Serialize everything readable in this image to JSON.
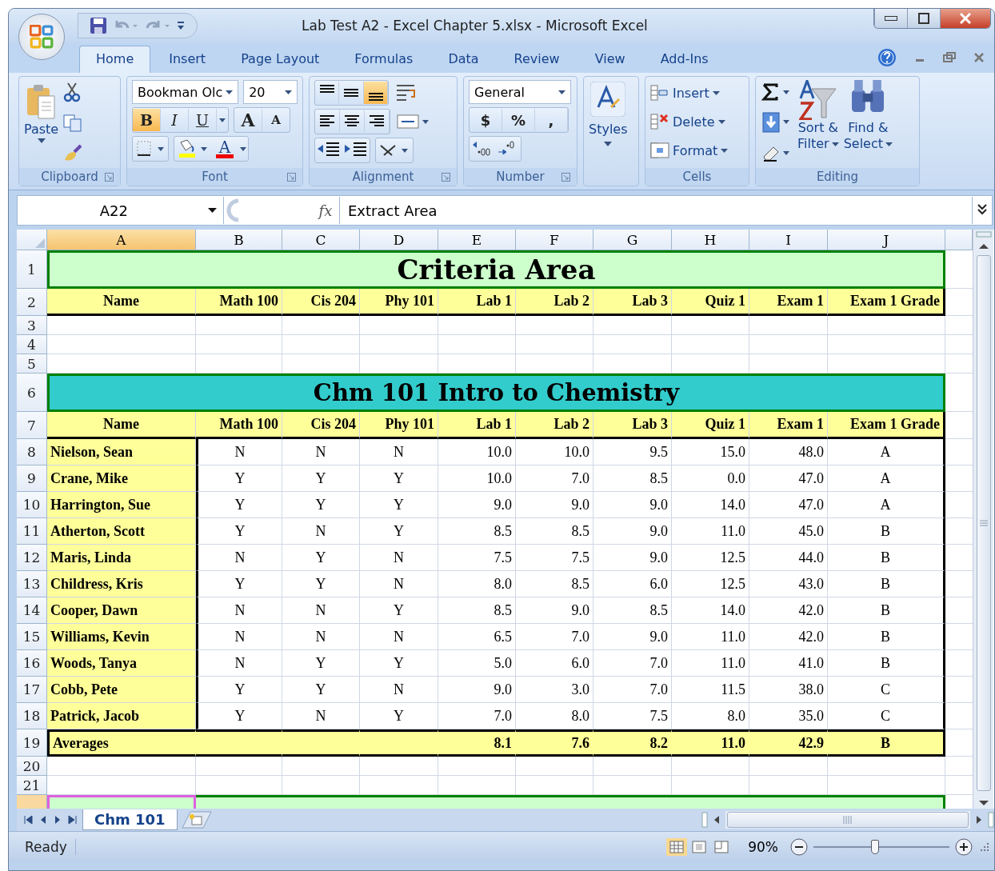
{
  "window": {
    "title": "Lab Test A2 - Excel Chapter 5.xlsx - Microsoft Excel"
  },
  "tabs": [
    {
      "label": "Home",
      "selected": true
    },
    {
      "label": "Insert",
      "selected": false
    },
    {
      "label": "Page Layout",
      "selected": false
    },
    {
      "label": "Formulas",
      "selected": false
    },
    {
      "label": "Data",
      "selected": false
    },
    {
      "label": "Review",
      "selected": false
    },
    {
      "label": "View",
      "selected": false
    },
    {
      "label": "Add-Ins",
      "selected": false
    }
  ],
  "ribbon": {
    "clipboard": {
      "label": "Clipboard",
      "paste": "Paste"
    },
    "font": {
      "label": "Font",
      "name": "Bookman Olc",
      "size": "20",
      "styles": [
        {
          "text": "B",
          "kind": "bold",
          "selected": true
        },
        {
          "text": "I",
          "kind": "italic",
          "selected": false
        },
        {
          "text": "U",
          "kind": "underline",
          "selected": false
        }
      ],
      "grow": "A",
      "shrink": "A",
      "color_letter": "A"
    },
    "alignment": {
      "label": "Alignment",
      "vertical": [
        {
          "kind": "top",
          "selected": false
        },
        {
          "kind": "middle",
          "selected": false
        },
        {
          "kind": "bottom",
          "selected": true
        }
      ]
    },
    "number": {
      "label": "Number",
      "format": "General",
      "symbols": [
        "$",
        "%",
        ","
      ]
    },
    "styles": {
      "label": "Styles"
    },
    "cells": {
      "label": "Cells",
      "buttons": [
        "Insert",
        "Delete",
        "Format"
      ]
    },
    "editing": {
      "label": "Editing",
      "sort": [
        "Sort &",
        "Filter"
      ],
      "find": [
        "Find &",
        "Select"
      ]
    }
  },
  "formula_bar": {
    "name_box": "A22",
    "fx": "fx",
    "formula": "Extract Area"
  },
  "columns": [
    {
      "label": "A",
      "selected": true
    },
    {
      "label": "B",
      "selected": false
    },
    {
      "label": "C",
      "selected": false
    },
    {
      "label": "D",
      "selected": false
    },
    {
      "label": "E",
      "selected": false
    },
    {
      "label": "F",
      "selected": false
    },
    {
      "label": "G",
      "selected": false
    },
    {
      "label": "H",
      "selected": false
    },
    {
      "label": "I",
      "selected": false
    },
    {
      "label": "J",
      "selected": false
    }
  ],
  "rows": [
    {
      "num": "1",
      "kind": "title",
      "title": "Criteria Area",
      "color": "#ccffcc"
    },
    {
      "num": "2",
      "kind": "header",
      "cells": [
        "Name",
        "Math 100",
        "Cis 204",
        "Phy 101",
        "Lab 1",
        "Lab 2",
        "Lab 3",
        "Quiz 1",
        "Exam 1",
        "Exam 1 Grade"
      ]
    },
    {
      "num": "3",
      "kind": "blank"
    },
    {
      "num": "4",
      "kind": "blank"
    },
    {
      "num": "5",
      "kind": "blank"
    },
    {
      "num": "6",
      "kind": "title",
      "title": "Chm 101 Intro to Chemistry",
      "color": "#33cccc"
    },
    {
      "num": "7",
      "kind": "header",
      "cells": [
        "Name",
        "Math 100",
        "Cis 204",
        "Phy 101",
        "Lab 1",
        "Lab 2",
        "Lab 3",
        "Quiz 1",
        "Exam 1",
        "Exam 1 Grade"
      ]
    },
    {
      "num": "8",
      "kind": "data",
      "cells": [
        "Nielson, Sean",
        "N",
        "N",
        "N",
        "10.0",
        "10.0",
        "9.5",
        "15.0",
        "48.0",
        "A"
      ]
    },
    {
      "num": "9",
      "kind": "data",
      "cells": [
        "Crane, Mike",
        "Y",
        "Y",
        "Y",
        "10.0",
        "7.0",
        "8.5",
        "0.0",
        "47.0",
        "A"
      ]
    },
    {
      "num": "10",
      "kind": "data",
      "cells": [
        "Harrington, Sue",
        "Y",
        "Y",
        "Y",
        "9.0",
        "9.0",
        "9.0",
        "14.0",
        "47.0",
        "A"
      ]
    },
    {
      "num": "11",
      "kind": "data",
      "cells": [
        "Atherton, Scott",
        "Y",
        "N",
        "Y",
        "8.5",
        "8.5",
        "9.0",
        "11.0",
        "45.0",
        "B"
      ]
    },
    {
      "num": "12",
      "kind": "data",
      "cells": [
        "Maris, Linda",
        "N",
        "Y",
        "N",
        "7.5",
        "7.5",
        "9.0",
        "12.5",
        "44.0",
        "B"
      ]
    },
    {
      "num": "13",
      "kind": "data",
      "cells": [
        "Childress, Kris",
        "Y",
        "Y",
        "N",
        "8.0",
        "8.5",
        "6.0",
        "12.5",
        "43.0",
        "B"
      ]
    },
    {
      "num": "14",
      "kind": "data",
      "cells": [
        "Cooper, Dawn",
        "N",
        "N",
        "Y",
        "8.5",
        "9.0",
        "8.5",
        "14.0",
        "42.0",
        "B"
      ]
    },
    {
      "num": "15",
      "kind": "data",
      "cells": [
        "Williams, Kevin",
        "N",
        "N",
        "N",
        "6.5",
        "7.0",
        "9.0",
        "11.0",
        "42.0",
        "B"
      ]
    },
    {
      "num": "16",
      "kind": "data",
      "cells": [
        "Woods, Tanya",
        "N",
        "Y",
        "Y",
        "5.0",
        "6.0",
        "7.0",
        "11.0",
        "41.0",
        "B"
      ]
    },
    {
      "num": "17",
      "kind": "data",
      "cells": [
        "Cobb, Pete",
        "Y",
        "Y",
        "N",
        "9.0",
        "3.0",
        "7.0",
        "11.5",
        "38.0",
        "C"
      ]
    },
    {
      "num": "18",
      "kind": "data",
      "cells": [
        "Patrick, Jacob",
        "Y",
        "N",
        "Y",
        "7.0",
        "8.0",
        "7.5",
        "8.0",
        "35.0",
        "C"
      ]
    },
    {
      "num": "19",
      "kind": "averages",
      "label": "Averages",
      "values": [
        "8.1",
        "7.6",
        "8.2",
        "11.0",
        "42.9",
        "B"
      ]
    },
    {
      "num": "20",
      "kind": "blank"
    },
    {
      "num": "21",
      "kind": "blank"
    },
    {
      "kind": "title",
      "color": "#ccffcc",
      "selected": true
    }
  ],
  "sheet_tabs": [
    {
      "label": "Chm 101",
      "selected": true
    }
  ],
  "status_bar": {
    "status": "Ready",
    "zoom": "90%",
    "level": 0.45
  }
}
